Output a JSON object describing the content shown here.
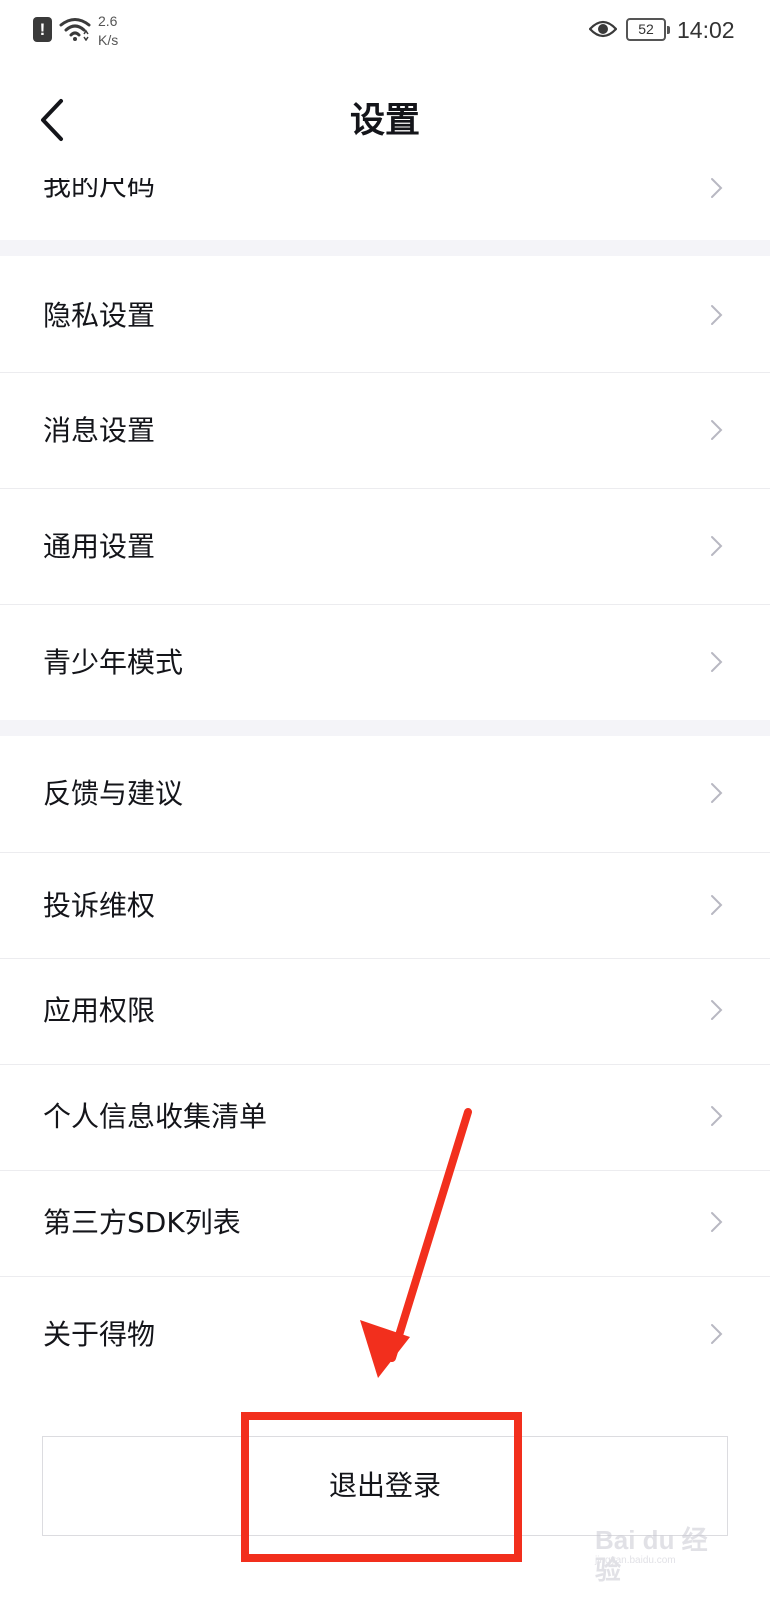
{
  "status_bar": {
    "net_speed_value": "2.6",
    "net_speed_unit": "K/s",
    "battery": "52",
    "time": "14:02",
    "icons": [
      "alert-icon",
      "wifi-icon",
      "eye-icon",
      "battery-icon"
    ]
  },
  "nav": {
    "title": "设置",
    "back_icon": "chevron-left-icon"
  },
  "groups": [
    {
      "items": [
        {
          "label": "我的尺码"
        }
      ]
    },
    {
      "items": [
        {
          "label": "隐私设置"
        },
        {
          "label": "消息设置"
        },
        {
          "label": "通用设置"
        },
        {
          "label": "青少年模式"
        }
      ]
    },
    {
      "items": [
        {
          "label": "反馈与建议"
        },
        {
          "label": "投诉维权"
        },
        {
          "label": "应用权限"
        },
        {
          "label": "个人信息收集清单"
        },
        {
          "label": "第三方SDK列表"
        },
        {
          "label": "关于得物"
        }
      ]
    }
  ],
  "logout": {
    "label": "退出登录"
  },
  "annotation": {
    "color": "#f22f1d",
    "icons": [
      "arrow-icon",
      "highlight-box"
    ]
  },
  "colors": {
    "accent_red": "#f22f1d",
    "section_gap": "#f4f4f8",
    "text": "#14151a",
    "chevron": "#b8b8c2"
  },
  "watermark": {
    "brand": "Bai du 经验",
    "url": "jingyan.baidu.com"
  }
}
